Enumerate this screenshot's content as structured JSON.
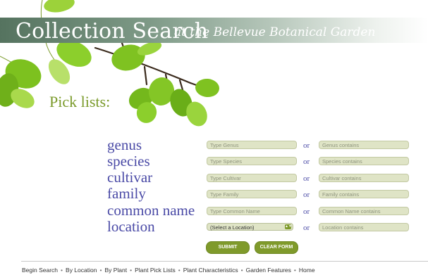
{
  "header": {
    "title": "Collection Search",
    "subtitle": "at the Bellevue Botanical Garden"
  },
  "section_title": "Pick lists:",
  "rows": [
    {
      "label": "genus",
      "placeholder": "Type Genus",
      "or": "or",
      "contains_placeholder": "Genus contains"
    },
    {
      "label": "species",
      "placeholder": "Type Species",
      "or": "or",
      "contains_placeholder": "Species contains"
    },
    {
      "label": "cultivar",
      "placeholder": "Type Cultivar",
      "or": "or",
      "contains_placeholder": "Cultivar contains"
    },
    {
      "label": "family",
      "placeholder": "Type Family",
      "or": "or",
      "contains_placeholder": "Family contains"
    },
    {
      "label": "common name",
      "placeholder": "Type Common Name",
      "or": "or",
      "contains_placeholder": "Common Name contains"
    },
    {
      "label": "location",
      "select_value": "(Select a Location)",
      "or": "or",
      "contains_placeholder": "Location contains"
    }
  ],
  "buttons": {
    "submit": "SUBMIT",
    "clear": "CLEAR FORM"
  },
  "footer": {
    "links": [
      "Begin Search",
      "By Location",
      "By Plant",
      "Plant Pick Lists",
      "Plant Characteristics",
      "Garden Features",
      "Home"
    ],
    "separator": "•"
  },
  "colors": {
    "label": "#4a4aa6",
    "accent_green": "#7f9a2b",
    "field_bg": "#dfe4c6"
  }
}
